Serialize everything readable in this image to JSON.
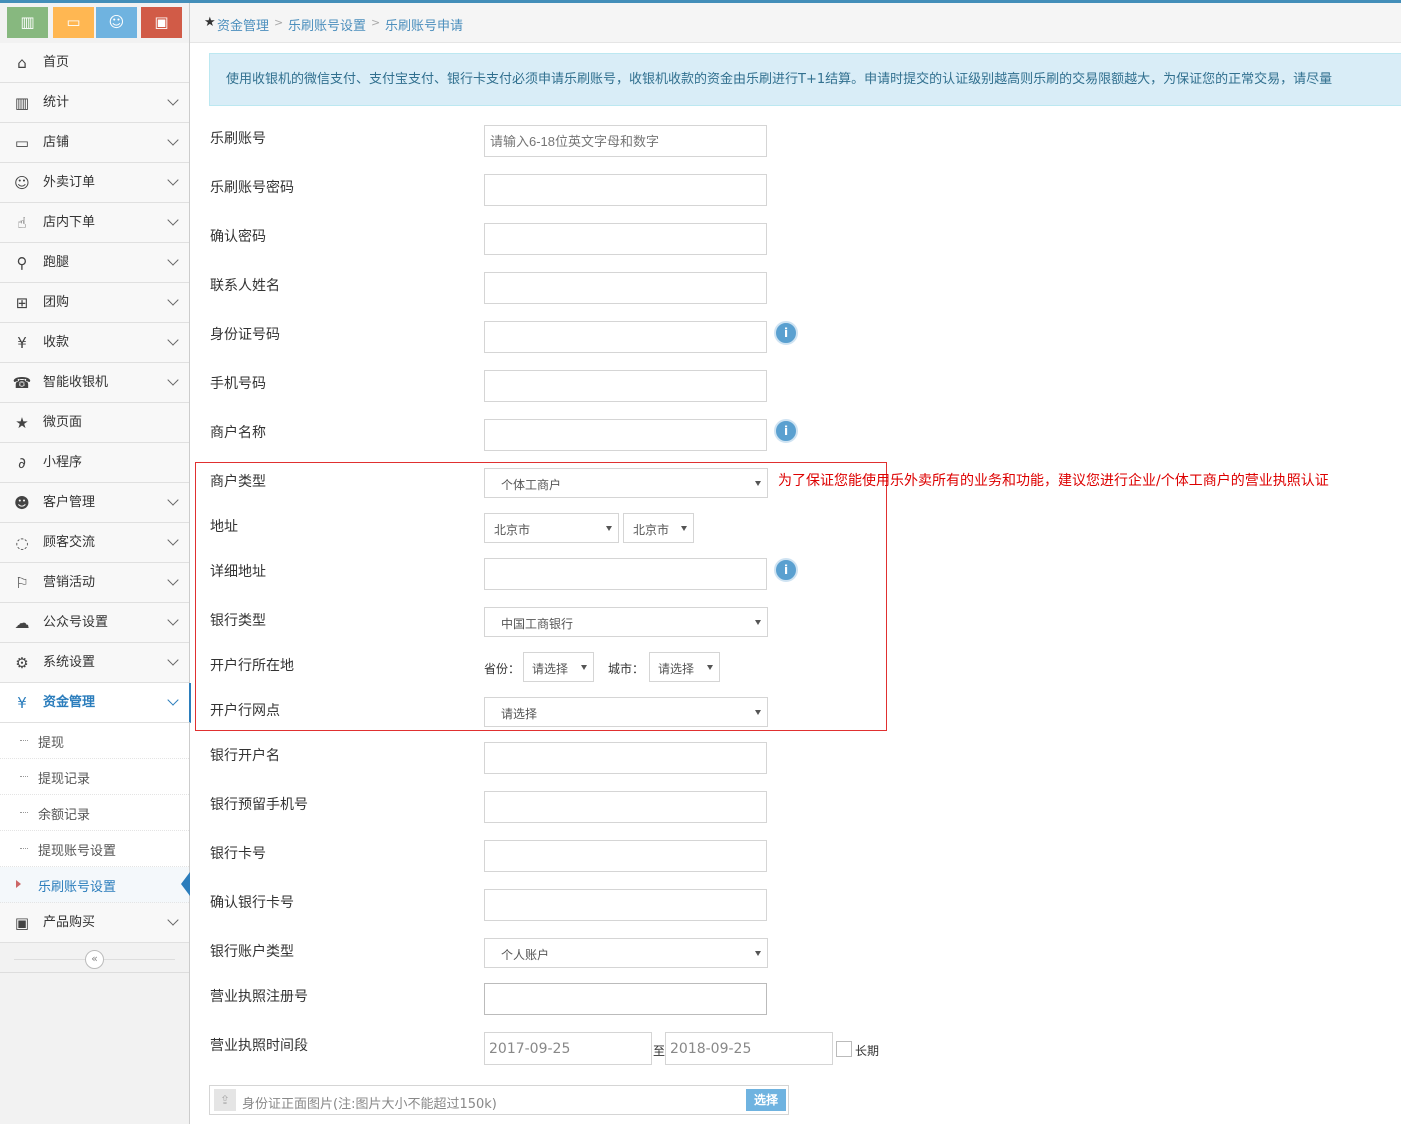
{
  "sidebar": {
    "shortcut_colors": [
      "#87b87f",
      "#ffb752",
      "#6fb3e0",
      "#d15b47"
    ],
    "shortcut_icons": [
      "bar-chart-icon",
      "monitor-icon",
      "smile-icon",
      "bag-icon"
    ],
    "items": [
      {
        "label": "首页",
        "icon": "home-icon",
        "glyph": "⌂"
      },
      {
        "label": "统计",
        "icon": "bar-chart-icon",
        "glyph": "▥"
      },
      {
        "label": "店铺",
        "icon": "monitor-icon",
        "glyph": "▭"
      },
      {
        "label": "外卖订单",
        "icon": "smile-icon",
        "glyph": "☺"
      },
      {
        "label": "店内下单",
        "icon": "hand-pointer-icon",
        "glyph": "☝"
      },
      {
        "label": "跑腿",
        "icon": "bicycle-icon",
        "glyph": "⚲"
      },
      {
        "label": "团购",
        "icon": "cart-icon",
        "glyph": "⊞"
      },
      {
        "label": "收款",
        "icon": "yen-icon",
        "glyph": "¥"
      },
      {
        "label": "智能收银机",
        "icon": "cash-register-icon",
        "glyph": "☎"
      },
      {
        "label": "微页面",
        "icon": "star-icon",
        "glyph": "★"
      },
      {
        "label": "小程序",
        "icon": "link-icon",
        "glyph": "∂"
      },
      {
        "label": "客户管理",
        "icon": "users-icon",
        "glyph": "☻"
      },
      {
        "label": "顾客交流",
        "icon": "comments-icon",
        "glyph": "◌"
      },
      {
        "label": "营销活动",
        "icon": "flag-icon",
        "glyph": "⚐"
      },
      {
        "label": "公众号设置",
        "icon": "wechat-icon",
        "glyph": "☁"
      },
      {
        "label": "系统设置",
        "icon": "gear-icon",
        "glyph": "⚙"
      },
      {
        "label": "资金管理",
        "icon": "yen-icon",
        "glyph": "¥"
      }
    ],
    "sub_items": [
      {
        "label": "提现"
      },
      {
        "label": "提现记录"
      },
      {
        "label": "余额记录"
      },
      {
        "label": "提现账号设置"
      },
      {
        "label": "乐刷账号设置"
      }
    ],
    "last_item": {
      "label": "产品购买",
      "icon": "briefcase-icon",
      "glyph": "▣"
    },
    "collapse_glyph": "«"
  },
  "breadcrumb": {
    "items": [
      "资金管理",
      "乐刷账号设置",
      "乐刷账号申请"
    ],
    "star": "★",
    "sep": ">"
  },
  "notice": "使用收银机的微信支付、支付宝支付、银行卡支付必须申请乐刷账号，收银机收款的资金由乐刷进行T+1结算。申请时提交的认证级别越高则乐刷的交易限额越大，为保证您的正常交易，请尽量",
  "form": {
    "account_label": "乐刷账号",
    "account_placeholder": "请输入6-18位英文字母和数字",
    "password_label": "乐刷账号密码",
    "confirm_password_label": "确认密码",
    "contact_label": "联系人姓名",
    "idcard_label": "身份证号码",
    "phone_label": "手机号码",
    "merchant_name_label": "商户名称",
    "merchant_type_label": "商户类型",
    "merchant_type_value": "个体工商户",
    "merchant_type_hint": "为了保证您能使用乐外卖所有的业务和功能，建议您进行企业/个体工商户的营业执照认证",
    "address_label": "地址",
    "province_value": "北京市",
    "city_value": "北京市",
    "detail_address_label": "详细地址",
    "bank_type_label": "银行类型",
    "bank_type_value": "中国工商银行",
    "bank_location_label": "开户行所在地",
    "bank_province_label": "省份：",
    "bank_province_value": "请选择",
    "bank_city_label": "城市：",
    "bank_city_value": "请选择",
    "bank_branch_label": "开户行网点",
    "bank_branch_value": "请选择",
    "bank_account_name_label": "银行开户名",
    "bank_phone_label": "银行预留手机号",
    "bank_card_label": "银行卡号",
    "bank_card_confirm_label": "确认银行卡号",
    "bank_account_type_label": "银行账户类型",
    "bank_account_type_value": "个人账户",
    "license_no_label": "营业执照注册号",
    "license_period_label": "营业执照时间段",
    "date_from": "2017-09-25",
    "date_to_sep": "至",
    "date_to": "2018-09-25",
    "long_term_label": "长期",
    "upload_text": "身份证正面图片(注:图片大小不能超过150k)",
    "upload_button": "选择",
    "info_glyph": "i"
  }
}
